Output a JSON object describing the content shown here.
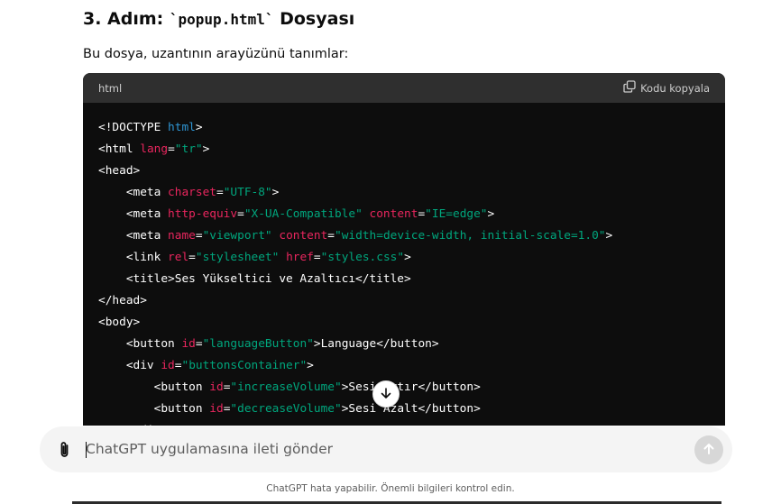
{
  "section": {
    "heading_prefix": "3. Adım: ",
    "heading_code": "`popup.html`",
    "heading_suffix": " Dosyası",
    "description": "Bu dosya, uzantının arayüzünü tanımlar:"
  },
  "code_block": {
    "language": "html",
    "copy_label": "Kodu kopyala",
    "lines": [
      [
        [
          "tag",
          "<!DOCTYPE "
        ],
        [
          "kw",
          "html"
        ],
        [
          "tag",
          ">"
        ]
      ],
      [
        [
          "tag",
          "<html "
        ],
        [
          "attr",
          "lang"
        ],
        [
          "tag",
          "="
        ],
        [
          "str",
          "\"tr\""
        ],
        [
          "tag",
          ">"
        ]
      ],
      [
        [
          "tag",
          "<head>"
        ]
      ],
      [
        [
          "tag",
          "    <meta "
        ],
        [
          "attr",
          "charset"
        ],
        [
          "tag",
          "="
        ],
        [
          "str",
          "\"UTF-8\""
        ],
        [
          "tag",
          ">"
        ]
      ],
      [
        [
          "tag",
          "    <meta "
        ],
        [
          "attr",
          "http-equiv"
        ],
        [
          "tag",
          "="
        ],
        [
          "str",
          "\"X-UA-Compatible\""
        ],
        [
          "tag",
          " "
        ],
        [
          "attr",
          "content"
        ],
        [
          "tag",
          "="
        ],
        [
          "str",
          "\"IE=edge\""
        ],
        [
          "tag",
          ">"
        ]
      ],
      [
        [
          "tag",
          "    <meta "
        ],
        [
          "attr",
          "name"
        ],
        [
          "tag",
          "="
        ],
        [
          "str",
          "\"viewport\""
        ],
        [
          "tag",
          " "
        ],
        [
          "attr",
          "content"
        ],
        [
          "tag",
          "="
        ],
        [
          "str",
          "\"width=device-width, initial-scale=1.0\""
        ],
        [
          "tag",
          ">"
        ]
      ],
      [
        [
          "tag",
          "    <link "
        ],
        [
          "attr",
          "rel"
        ],
        [
          "tag",
          "="
        ],
        [
          "str",
          "\"stylesheet\""
        ],
        [
          "tag",
          " "
        ],
        [
          "attr",
          "href"
        ],
        [
          "tag",
          "="
        ],
        [
          "str",
          "\"styles.css\""
        ],
        [
          "tag",
          ">"
        ]
      ],
      [
        [
          "tag",
          "    <title>Ses Yükseltici ve Azaltıcı</title>"
        ]
      ],
      [
        [
          "tag",
          "</head>"
        ]
      ],
      [
        [
          "tag",
          "<body>"
        ]
      ],
      [
        [
          "tag",
          "    <button "
        ],
        [
          "attr",
          "id"
        ],
        [
          "tag",
          "="
        ],
        [
          "str",
          "\"languageButton\""
        ],
        [
          "tag",
          ">Language</button>"
        ]
      ],
      [
        [
          "tag",
          "    <div "
        ],
        [
          "attr",
          "id"
        ],
        [
          "tag",
          "="
        ],
        [
          "str",
          "\"buttonsContainer\""
        ],
        [
          "tag",
          ">"
        ]
      ],
      [
        [
          "tag",
          "        <button "
        ],
        [
          "attr",
          "id"
        ],
        [
          "tag",
          "="
        ],
        [
          "str",
          "\"increaseVolume\""
        ],
        [
          "tag",
          ">Sesi Artır</button>"
        ]
      ],
      [
        [
          "tag",
          "        <button "
        ],
        [
          "attr",
          "id"
        ],
        [
          "tag",
          "="
        ],
        [
          "str",
          "\"decreaseVolume\""
        ],
        [
          "tag",
          ">Sesi Azalt</button>"
        ]
      ],
      [
        [
          "tag",
          "    </div>"
        ]
      ]
    ]
  },
  "composer": {
    "placeholder": "ChatGPT uygulamasına ileti gönder"
  },
  "footer": {
    "disclaimer": "ChatGPT hata yapabilir. Önemli bilgileri kontrol edin."
  },
  "icons": {
    "copy": "copy-icon",
    "scroll_down": "arrow-down-icon",
    "attach": "paperclip-icon",
    "send": "arrow-up-icon"
  },
  "colors": {
    "code_bg": "#0d0d0d",
    "code_header_bg": "#2f2f2f",
    "attr": "#e9265e",
    "string": "#00a67d",
    "keyword": "#2e95d3",
    "composer_bg": "#f4f4f4",
    "send_disabled": "#d7d7d7"
  }
}
